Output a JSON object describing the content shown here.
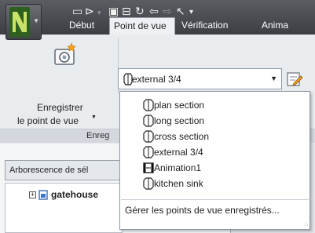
{
  "qat": {
    "icons": [
      "new-icon",
      "open-icon",
      "save-icon",
      "print-icon",
      "refresh-icon",
      "undo-icon",
      "redo-icon",
      "select-icon",
      "customize-icon"
    ]
  },
  "tabs": {
    "debut": "Début",
    "point_de_vue": "Point de vue",
    "verification": "Vérification",
    "anim": "Anima"
  },
  "ribbon": {
    "save_view_line1": "Enregistrer",
    "save_view_line2": "le point de vue",
    "group_label": "Enreg",
    "combo_value": "external 3/4",
    "colors": {
      "accent": "#c8e26a",
      "dropdown_border": "#8e98a6"
    }
  },
  "dropdown": {
    "items": [
      {
        "label": "plan section",
        "icon": "viewpoint-icon"
      },
      {
        "label": "long section",
        "icon": "viewpoint-icon"
      },
      {
        "label": "cross section",
        "icon": "viewpoint-icon"
      },
      {
        "label": "external 3/4",
        "icon": "viewpoint-icon"
      },
      {
        "label": "Animation1",
        "icon": "animation-icon"
      },
      {
        "label": "kitchen sink",
        "icon": "viewpoint-icon"
      }
    ],
    "manage": "Gérer les points de vue enregistrés..."
  },
  "pane": {
    "title": "Arborescence de sél",
    "tree_item": "gatehouse"
  }
}
